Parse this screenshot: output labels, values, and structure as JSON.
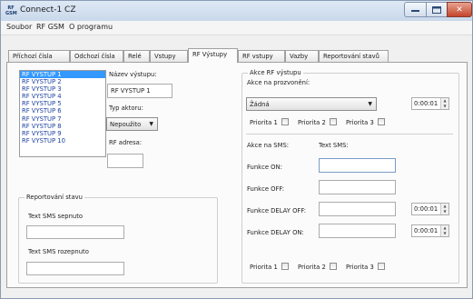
{
  "window": {
    "title": "Connect-1  CZ",
    "app_icon_label": "RF GSM",
    "buttons": {
      "minimize": "",
      "maximize": "",
      "close": "✕"
    }
  },
  "menu": [
    "Soubor",
    "RF GSM",
    "O programu"
  ],
  "tabs": [
    "Příchozí čísla",
    "Odchozí čísla",
    "Relé",
    "Vstupy",
    "RF Výstupy",
    "RF vstupy",
    "Vazby",
    "Reportování stavů"
  ],
  "active_tab": "RF Výstupy",
  "outputs_list": {
    "items": [
      "RF VYSTUP 1",
      "RF VYSTUP 2",
      "RF VYSTUP 3",
      "RF VYSTUP 4",
      "RF VYSTUP 5",
      "RF VYSTUP 6",
      "RF VYSTUP 7",
      "RF VYSTUP 8",
      "RF VYSTUP 9",
      "RF VYSTUP 10"
    ],
    "selected": "RF VYSTUP 1"
  },
  "output_detail": {
    "name_label": "Název výstupu:",
    "name_value": "RF VYSTUP 1",
    "actuator_label": "Typ aktoru:",
    "actuator_value": "Nepoužito",
    "address_label": "RF adresa:",
    "address_value": ""
  },
  "report": {
    "group_title": "Reportování stavu",
    "on_label": "Text SMS sepnuto",
    "on_value": "",
    "off_label": "Text SMS rozepnuto",
    "off_value": ""
  },
  "actions": {
    "group_title": "Akce RF výstupu",
    "ring_label": "Akce na prozvonění:",
    "ring_value": "Žádná",
    "ring_time": "0:00:01",
    "priorities_top": [
      "Priorita 1",
      "Priorita 2",
      "Priorita 3"
    ],
    "sms_label": "Akce na SMS:",
    "sms_text_label": "Text SMS:",
    "func_on_label": "Funkce ON:",
    "func_off_label": "Funkce OFF:",
    "delay_off_label": "Funkce DELAY OFF:",
    "delay_off_time": "0:00:01",
    "delay_on_label": "Funkce DELAY ON:",
    "delay_on_time": "0:00:01",
    "priorities_bottom": [
      "Priorita 1",
      "Priorita 2",
      "Priorita 3"
    ]
  }
}
